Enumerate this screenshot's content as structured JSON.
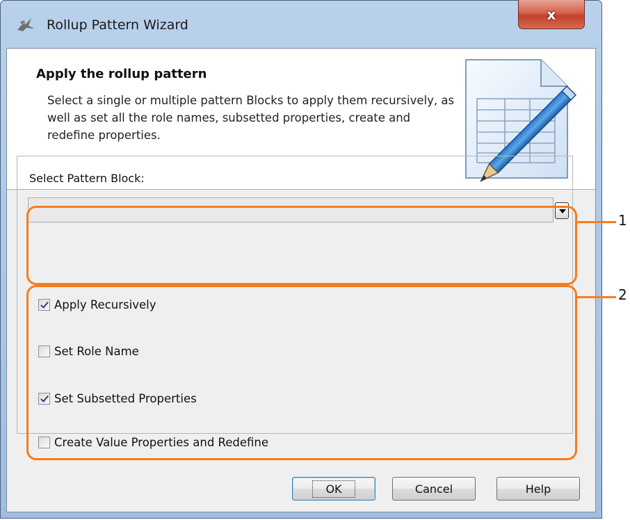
{
  "window": {
    "title": "Rollup Pattern Wizard",
    "close_label": "x"
  },
  "header": {
    "title": "Apply the rollup pattern",
    "description": "Select a single or multiple pattern Blocks to apply them recursively, as well as set all the role names, subsetted properties, create and redefine properties."
  },
  "pattern_block": {
    "label": "Select Pattern Block:",
    "selected_value": ""
  },
  "options": [
    {
      "label": "Apply Recursively",
      "checked": true
    },
    {
      "label": "Set Role Name",
      "checked": false
    },
    {
      "label": "Set Subsetted Properties",
      "checked": true
    },
    {
      "label": "Create Value Properties and Redefine",
      "checked": false
    }
  ],
  "callouts": [
    "1",
    "2"
  ],
  "buttons": {
    "ok": "OK",
    "cancel": "Cancel",
    "help": "Help"
  },
  "colors": {
    "highlight": "#f57d1f",
    "titlebar": "#b9d1ea",
    "close_button": "#c3412a"
  }
}
